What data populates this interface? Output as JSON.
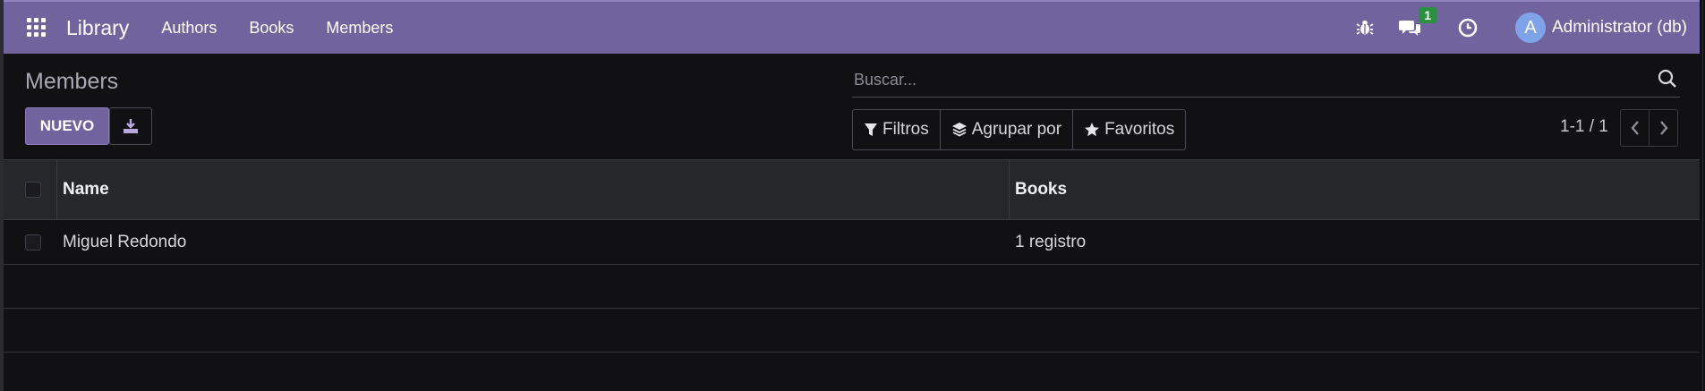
{
  "navbar": {
    "brand": "Library",
    "menu": [
      {
        "label": "Authors"
      },
      {
        "label": "Books"
      },
      {
        "label": "Members"
      }
    ],
    "messages_badge": "1",
    "user_initial": "A",
    "user_name": "Administrator (db)",
    "color": "#71639e"
  },
  "control_panel": {
    "title": "Members",
    "new_button": "NUEVO",
    "search_placeholder": "Buscar...",
    "filters_label": "Filtros",
    "group_by_label": "Agrupar por",
    "favorites_label": "Favoritos",
    "pager": "1-1 / 1"
  },
  "table": {
    "columns": [
      "Name",
      "Books"
    ],
    "rows": [
      {
        "name": "Miguel Redondo",
        "books": "1 registro"
      }
    ]
  },
  "icons": [
    "apps-grid-icon",
    "bug-icon",
    "chat-icon",
    "clock-icon",
    "download-icon",
    "search-icon",
    "filter-icon",
    "layers-icon",
    "star-icon",
    "chevron-left-icon",
    "chevron-right-icon"
  ]
}
